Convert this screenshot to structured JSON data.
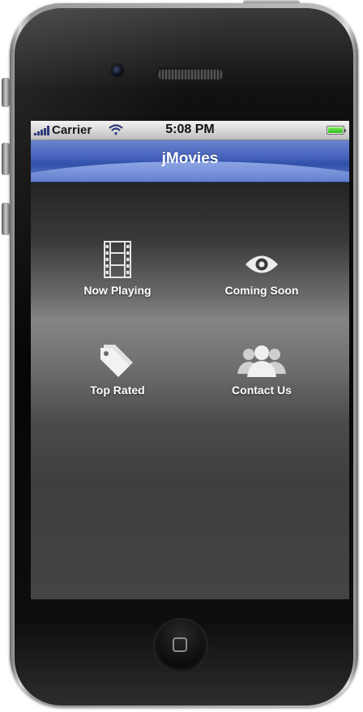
{
  "status_bar": {
    "carrier": "Carrier",
    "time": "5:08 PM",
    "battery_level": 1.0,
    "icons": [
      "signal-bars-icon",
      "wifi-icon",
      "battery-icon"
    ]
  },
  "nav_bar": {
    "title": "jMovies"
  },
  "menu": {
    "items": [
      {
        "label": "Now Playing",
        "icon": "film-strip-icon"
      },
      {
        "label": "Coming Soon",
        "icon": "eye-icon"
      },
      {
        "label": "Top Rated",
        "icon": "tag-icon"
      },
      {
        "label": "Contact Us",
        "icon": "people-icon"
      }
    ]
  },
  "colors": {
    "nav_bar": "#3c5ab9",
    "icon": "#e6e6e6",
    "label": "#ffffff"
  }
}
